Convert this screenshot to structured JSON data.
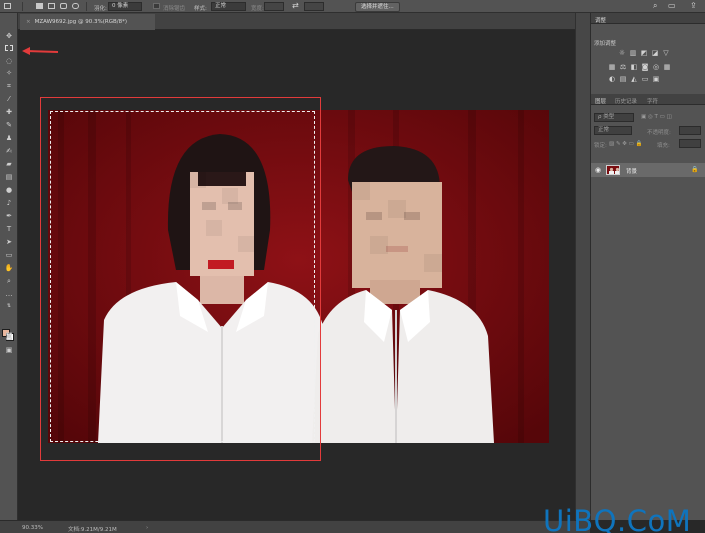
{
  "options_bar": {
    "feather_label": "羽化:",
    "feather_value": "0 像素",
    "antialias_label": "消除锯齿",
    "style_label": "样式:",
    "style_value": "正常",
    "width_label": "宽度:",
    "select_mask_button": "选择并遮住..."
  },
  "document": {
    "tab_title": "MZAW9692.jpg @ 90.3%(RGB/8*)",
    "close_glyph": "×"
  },
  "status_bar": {
    "zoom": "90.33%",
    "doc_size": "文档:9.21M/9.21M"
  },
  "adjustments_panel": {
    "tab": "调整",
    "add_label": "添加调整"
  },
  "layers_panel": {
    "tabs": [
      "图层",
      "历史记录",
      "字符"
    ],
    "kind_filter": "ρ 类型",
    "blend_mode": "正常",
    "opacity_label": "不透明度:",
    "lock_label": "锁定:",
    "fill_label": "填充:",
    "layer_name": "背景"
  },
  "watermark": "UiBQ.CoM",
  "colors": {
    "annotation": "#e23b3b",
    "foreground": "#e9b79e",
    "background": "#ffffff",
    "photo_backdrop": "#7a0d10",
    "watermark": "#0f74bd"
  }
}
